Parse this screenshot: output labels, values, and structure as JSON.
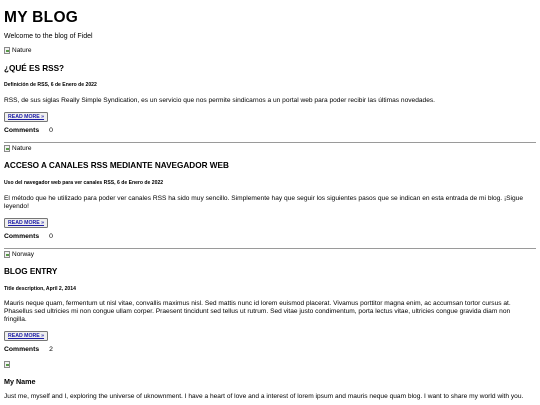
{
  "site": {
    "title": "MY BLOG",
    "welcome": "Welcome to the blog of Fidel"
  },
  "posts": [
    {
      "image_alt": "Nature",
      "title": "¿QUÉ ES RSS?",
      "description": "Definición de RSS, 6 de Enero de 2022",
      "body": "RSS, de sus siglas Really Simple Syndication, es un servicio que nos permite sindicarnos a un portal web para poder recibir las últimas novedades.",
      "read_more": "READ MORE »",
      "comments_label": "Comments",
      "comments_count": "0"
    },
    {
      "image_alt": "Nature",
      "title": "ACCESO A CANALES RSS MEDIANTE NAVEGADOR WEB",
      "description": "Uso del navegador web para ver canales RSS, 6 de Enero de 2022",
      "body": "El método que he utilizado para poder ver canales RSS ha sido muy sencillo. Simplemente hay que seguir los siguientes pasos que se indican en esta entrada de mi blog. ¡Sigue leyendo!",
      "read_more": "READ MORE »",
      "comments_label": "Comments",
      "comments_count": "0"
    },
    {
      "image_alt": "Norway",
      "title": "BLOG ENTRY",
      "description": "Title description, April 2, 2014",
      "body": "Mauris neque quam, fermentum ut nisl vitae, convallis maximus nisl. Sed mattis nunc id lorem euismod placerat. Vivamus porttitor magna enim, ac accumsan tortor cursus at. Phasellus sed ultricies mi non congue ullam corper. Praesent tincidunt sed tellus ut rutrum. Sed vitae justo condimentum, porta lectus vitae, ultricies congue gravida diam non fringilla.",
      "read_more": "READ MORE »",
      "comments_label": "Comments",
      "comments_count": "2"
    }
  ],
  "about": {
    "title": "My Name",
    "body": "Just me, myself and I, exploring the universe of uknownment. I have a heart of love and a interest of lorem ipsum and mauris neque quam blog. I want to share my world with you."
  }
}
